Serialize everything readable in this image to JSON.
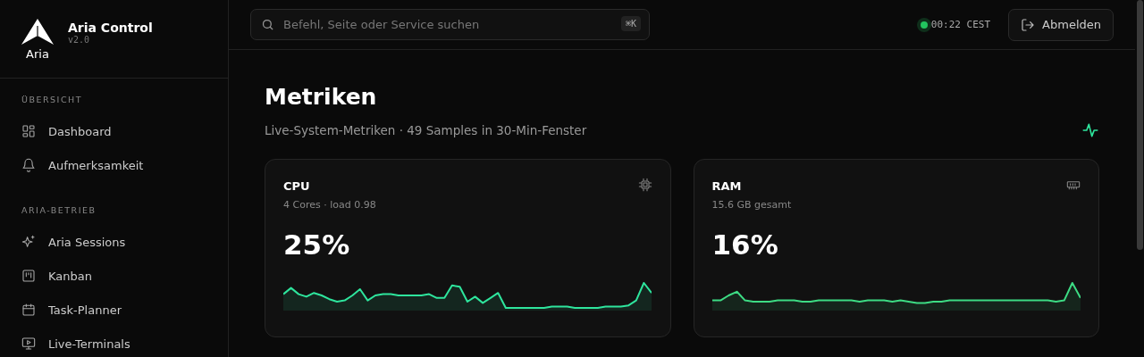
{
  "brand": {
    "logo_text": "Aria",
    "name": "Aria Control",
    "version": "v2.0"
  },
  "sidebar": {
    "sections": [
      {
        "title": "ÜBERSICHT",
        "items": [
          {
            "label": "Dashboard",
            "kind": "grid"
          },
          {
            "label": "Aufmerksamkeit",
            "kind": "bell"
          }
        ]
      },
      {
        "title": "ARIA-BETRIEB",
        "items": [
          {
            "label": "Aria Sessions",
            "kind": "sparkle"
          },
          {
            "label": "Kanban",
            "kind": "kanban"
          },
          {
            "label": "Task-Planner",
            "kind": "calendar"
          },
          {
            "label": "Live-Terminals",
            "kind": "monitor"
          }
        ]
      }
    ]
  },
  "header": {
    "search": {
      "placeholder": "Befehl, Seite oder Service suchen",
      "shortcut": "⌘K"
    },
    "clock": {
      "connected": true,
      "time": "00:22 CEST"
    },
    "logout": "Abmelden"
  },
  "page": {
    "title": "Metriken",
    "subtitle": "Live-System-Metriken · 49 Samples in 30-Min-Fenster"
  },
  "metrics": [
    {
      "kind": "cpu",
      "title": "CPU",
      "detail": "4 Cores · load 0.98",
      "value": "25%",
      "color": "#2ee59d"
    },
    {
      "kind": "ram",
      "title": "RAM",
      "detail": "15.6 GB gesamt",
      "value": "16%",
      "color": "#3ddc84"
    }
  ]
}
